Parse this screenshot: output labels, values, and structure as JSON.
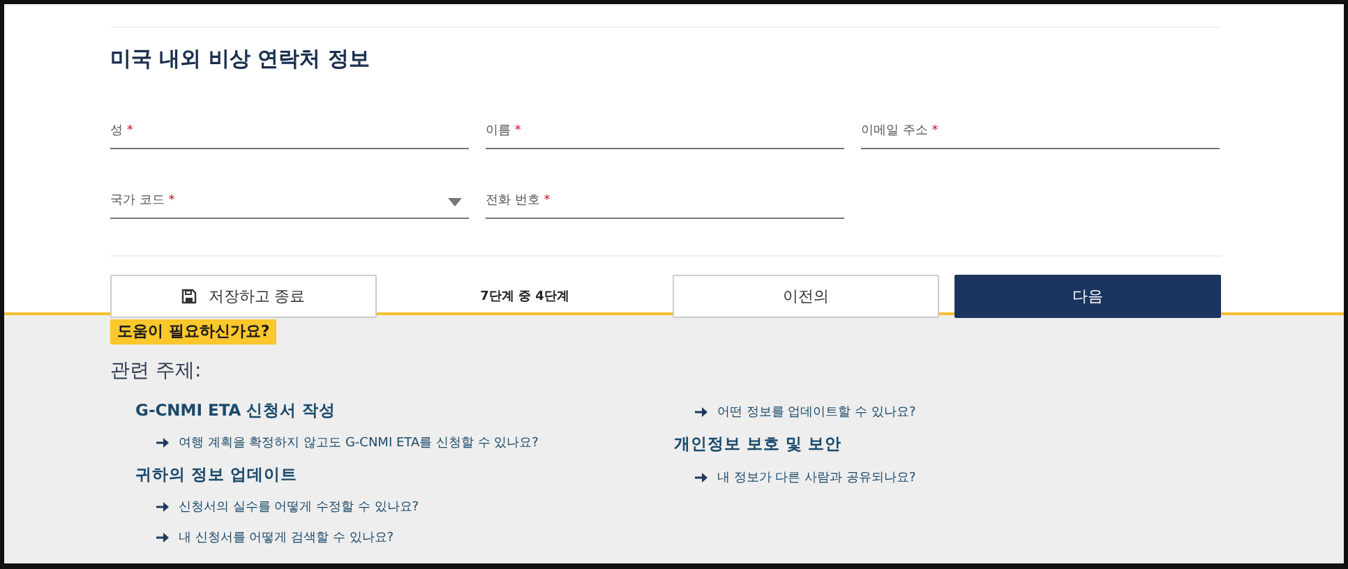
{
  "form": {
    "title": "미국 내외 비상 연락처 정보",
    "rows": [
      [
        {
          "kind": "text",
          "label": "성",
          "mark": "*"
        },
        {
          "kind": "text",
          "label": "이름",
          "mark": "*"
        },
        {
          "kind": "text",
          "label": "이메일 주소",
          "mark": "*"
        }
      ],
      [
        {
          "kind": "select",
          "label": "국가 코드",
          "mark": "*"
        },
        {
          "kind": "text",
          "label": "전화 번호",
          "mark": "*"
        }
      ]
    ]
  },
  "footer": {
    "save_button": "저장하고 종료",
    "step": "7단계 중 4단계",
    "back_button": "이전의",
    "next_button": "다음"
  },
  "help": {
    "badge": "도움이 필요하신가요?",
    "heading": "관련 주제:",
    "columns": [
      [
        {
          "kind": "heading",
          "text": "G-CNMI ETA 신청서 작성"
        },
        {
          "kind": "link",
          "text": "여행 계획을 확정하지 않고도 G-CNMI ETA를 신청할 수 있나요?"
        },
        {
          "kind": "heading",
          "text": "귀하의 정보 업데이트"
        },
        {
          "kind": "link",
          "text": "신청서의 실수를 어떻게 수정할 수 있나요?"
        },
        {
          "kind": "link",
          "text": "내 신청서를 어떻게 검색할 수 있나요?"
        }
      ],
      [
        {
          "kind": "link",
          "text": "어떤 정보를 업데이트할 수 있나요?"
        },
        {
          "kind": "heading",
          "text": "개인정보 보호 및 보안"
        },
        {
          "kind": "link",
          "text": "내 정보가 다른 사람과 공유되나요?"
        }
      ]
    ]
  }
}
